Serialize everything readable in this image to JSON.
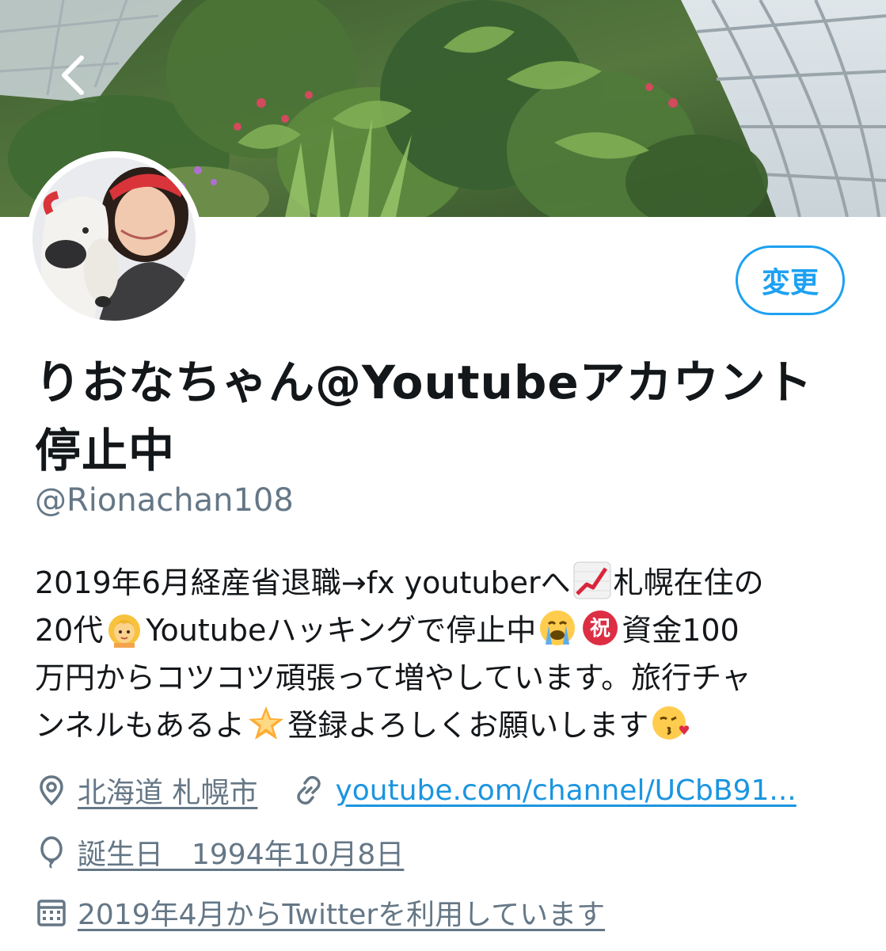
{
  "header": {
    "back_icon": "chevron-left-icon"
  },
  "profile": {
    "edit_label": "変更",
    "display_name": "りおなちゃん@Youtubeアカウント停止中",
    "handle": "@Rionachan108",
    "bio": {
      "line1a": "2019年6月経産省退職→fx youtuberへ",
      "line1b": "札幌在住の",
      "line2a": "20代",
      "line2b": "Youtubeハッキングで停止中",
      "line2c": "資金100",
      "line3": "万円からコツコツ頑張って増やしています。旅行チャ",
      "line4a": "ンネルもあるよ",
      "line4b": "登録よろしくお願いします"
    },
    "location": "北海道 札幌市",
    "website": "youtube.com/channel/UCbB91...",
    "birthday": "誕生日　1994年10月8日",
    "joined": "2019年4月からTwitterを利用しています"
  },
  "colors": {
    "accent": "#1da1f2",
    "link": "#1b95e0",
    "secondary_text": "#657786",
    "primary_text": "#14171a"
  },
  "icons": {
    "location": "location-pin-icon",
    "website": "link-icon",
    "birthday": "balloon-icon",
    "joined": "calendar-icon"
  }
}
